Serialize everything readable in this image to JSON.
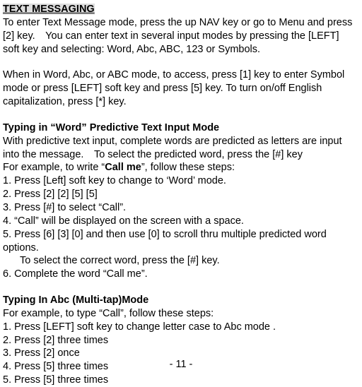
{
  "title": "TEXT MESSAGING",
  "intro_p1": "To enter Text Message mode, press the up NAV key or go to Menu and press [2] key. You can enter text in several input modes by pressing the [LEFT] soft key and selecting: Word, Abc, ABC, 123 or Symbols.",
  "intro_p2": "When in Word, Abc, or ABC mode, to access, press [1] key to enter Symbol mode or press [LEFT] soft key and press [5] key. To turn on/off English capitalization, press [*] key.",
  "word_head": "Typing in “Word” Predictive Text Input Mode",
  "word_p1": "With predictive text input, complete words are predicted as letters are input into the message. To select the predicted word, press the [#] key",
  "word_p2a": "For example, to write “",
  "word_p2_bold": "Call me",
  "word_p2b": "”, follow these steps:",
  "word_s1": "1. Press [Left] soft key to change to ‘Word’ mode.",
  "word_s2": "2. Press [2] [2] [5] [5]",
  "word_s3": "3. Press [#] to select “Call”.",
  "word_s4": "4. “Call” will be displayed on the screen with a space.",
  "word_s5": "5. Press [6] [3] [0] and then use [0] to scroll thru multiple predicted word options.",
  "word_s5b": "To select the correct word, press the [#] key.",
  "word_s6": "6. Complete the word “Call me”.",
  "abc_head": "Typing In Abc (Multi-tap)Mode",
  "abc_p1": "For example, to type “Call”, follow these steps:",
  "abc_s1": "1. Press [LEFT] soft key to change letter case to Abc mode .",
  "abc_s2": "2. Press [2] three times",
  "abc_s3": "3. Press [2] once",
  "abc_s4": "4. Press [5] three times",
  "abc_s5": "5. Press [5] three times",
  "page_num": "- 11 -"
}
